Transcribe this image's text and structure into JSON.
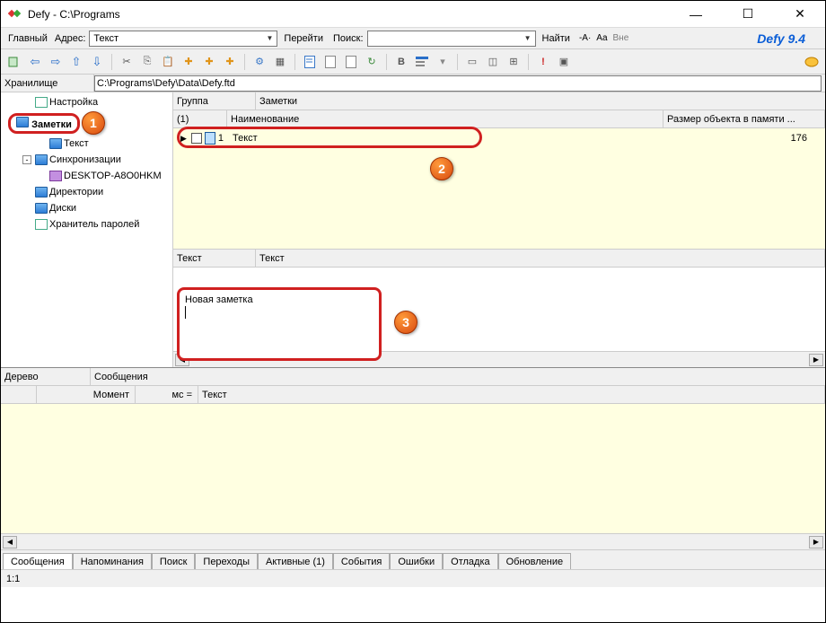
{
  "window": {
    "title": "Defy - C:\\Programs"
  },
  "nav": {
    "main_label": "Главный",
    "addr_label": "Адрес:",
    "addr_value": "Текст",
    "go_label": "Перейти",
    "search_label": "Поиск:",
    "search_value": "",
    "find_label": "Найти",
    "aa_small": "-A·",
    "aa_big": "Aa",
    "ext": "Вне",
    "brand": "Defy 9.4"
  },
  "repo": {
    "label": "Хранилище",
    "path": "C:\\Programs\\Defy\\Data\\Defy.ftd"
  },
  "tree": {
    "items": [
      {
        "label": "Настройка",
        "indent": 1,
        "icon": "doc",
        "exp": ""
      },
      {
        "label": "Заметки",
        "indent": 0,
        "icon": "folder",
        "exp": "",
        "hl": true
      },
      {
        "label": "Текст",
        "indent": 2,
        "icon": "folder",
        "exp": ""
      },
      {
        "label": "Синхронизации",
        "indent": 1,
        "icon": "folder",
        "exp": "-"
      },
      {
        "label": "DESKTOP-A8O0HKM",
        "indent": 2,
        "icon": "sync",
        "exp": ""
      },
      {
        "label": "Директории",
        "indent": 1,
        "icon": "folder",
        "exp": ""
      },
      {
        "label": "Диски",
        "indent": 1,
        "icon": "folder",
        "exp": ""
      },
      {
        "label": "Хранитель паролей",
        "indent": 1,
        "icon": "doc",
        "exp": ""
      }
    ]
  },
  "group": {
    "label": "Группа",
    "value": "Заметки"
  },
  "grid": {
    "col1": "(1)",
    "col2": "Наименование",
    "col3": "Размер объекта в памяти ...",
    "rows": [
      {
        "num": "1",
        "name": "Текст",
        "size": "176"
      }
    ]
  },
  "note": {
    "tab1": "Текст",
    "tab2": "Текст",
    "text": "Новая заметка"
  },
  "badges": {
    "b1": "1",
    "b2": "2",
    "b3": "3"
  },
  "msg": {
    "tree_label": "Дерево",
    "msgs_label": "Сообщения",
    "col_moment": "Момент",
    "col_ms": "мс =",
    "col_text": "Текст"
  },
  "tabs": [
    "Сообщения",
    "Напоминания",
    "Поиск",
    "Переходы",
    "Активные (1)",
    "События",
    "Ошибки",
    "Отладка",
    "Обновление"
  ],
  "status": "1:1"
}
